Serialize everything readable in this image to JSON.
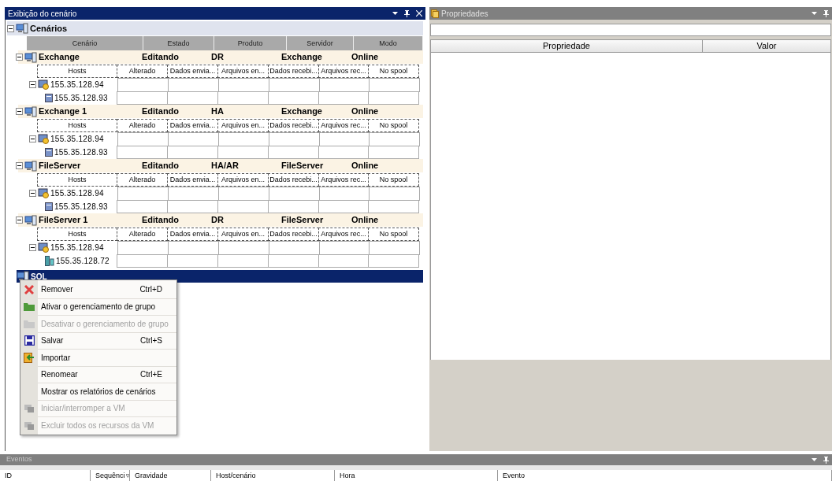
{
  "scenario_view": {
    "title": "Exibição do cenário",
    "root": {
      "label": "Cenários",
      "expanded": true
    },
    "columns": [
      "Cenário",
      "Estado",
      "Produto",
      "Servidor",
      "Modo"
    ],
    "scenarios": [
      {
        "name": "Exchange",
        "state": "Editando",
        "product": "DR",
        "server": "Exchange",
        "mode": "Online",
        "expanded": true,
        "host_columns": [
          "Hosts",
          "Alterado",
          "Dados envia...",
          "Arquivos en...",
          "Dados recebi...",
          "Arquivos rec...",
          "No spool"
        ],
        "hosts": [
          {
            "address": "155.35.128.94",
            "expanded": true,
            "children": [
              {
                "address": "155.35.128.93",
                "kind": "server"
              }
            ]
          }
        ]
      },
      {
        "name": "Exchange 1",
        "state": "Editando",
        "product": "HA",
        "server": "Exchange",
        "mode": "Online",
        "expanded": true,
        "host_columns": [
          "Hosts",
          "Alterado",
          "Dados envia...",
          "Arquivos en...",
          "Dados recebi...",
          "Arquivos rec...",
          "No spool"
        ],
        "hosts": [
          {
            "address": "155.35.128.94",
            "expanded": true,
            "children": [
              {
                "address": "155.35.128.93",
                "kind": "server"
              }
            ]
          }
        ]
      },
      {
        "name": "FileServer",
        "state": "Editando",
        "product": "HA/AR",
        "server": "FileServer",
        "mode": "Online",
        "expanded": true,
        "host_columns": [
          "Hosts",
          "Alterado",
          "Dados envia...",
          "Arquivos en...",
          "Dados recebi...",
          "Arquivos rec...",
          "No spool"
        ],
        "hosts": [
          {
            "address": "155.35.128.94",
            "expanded": true,
            "children": [
              {
                "address": "155.35.128.93",
                "kind": "server"
              }
            ]
          }
        ]
      },
      {
        "name": "FileServer 1",
        "state": "Editando",
        "product": "DR",
        "server": "FileServer",
        "mode": "Online",
        "expanded": true,
        "host_columns": [
          "Hosts",
          "Alterado",
          "Dados envia...",
          "Arquivos en...",
          "Dados recebi...",
          "Arquivos rec...",
          "No spool"
        ],
        "hosts": [
          {
            "address": "155.35.128.94",
            "expanded": true,
            "children": [
              {
                "address": "155.35.128.72",
                "kind": "cluster"
              }
            ]
          }
        ]
      }
    ],
    "groups": [
      {
        "label": "SQL",
        "selected": true
      }
    ],
    "context_menu": [
      {
        "label": "Remover",
        "shortcut": "Ctrl+D",
        "kind": "remove",
        "disabled": false
      },
      {
        "label": "Ativar o gerenciamento de grupo",
        "kind": "folder",
        "disabled": false
      },
      {
        "label": "Desativar o gerenciamento de grupo",
        "kind": "folder",
        "disabled": true
      },
      {
        "label": "Salvar",
        "shortcut": "Ctrl+S",
        "kind": "save",
        "disabled": false
      },
      {
        "label": "Importar",
        "kind": "import",
        "disabled": false
      },
      {
        "label": "Renomear",
        "shortcut": "Ctrl+E",
        "kind": "plain",
        "disabled": false
      },
      {
        "label": "Mostrar os relatórios de cenários",
        "kind": "plain",
        "disabled": false
      },
      {
        "label": "Iniciar/interromper a VM",
        "kind": "vm",
        "disabled": true
      },
      {
        "label": "Excluir todos os recursos da VM",
        "kind": "vm",
        "disabled": true
      }
    ]
  },
  "properties": {
    "title": "Propriedades",
    "columns": [
      "Propriedade",
      "Valor"
    ]
  },
  "events": {
    "title": "Eventos",
    "columns": [
      "ID",
      "Sequênci",
      "Gravidade",
      "Host/cenário",
      "Hora",
      "Evento"
    ]
  }
}
